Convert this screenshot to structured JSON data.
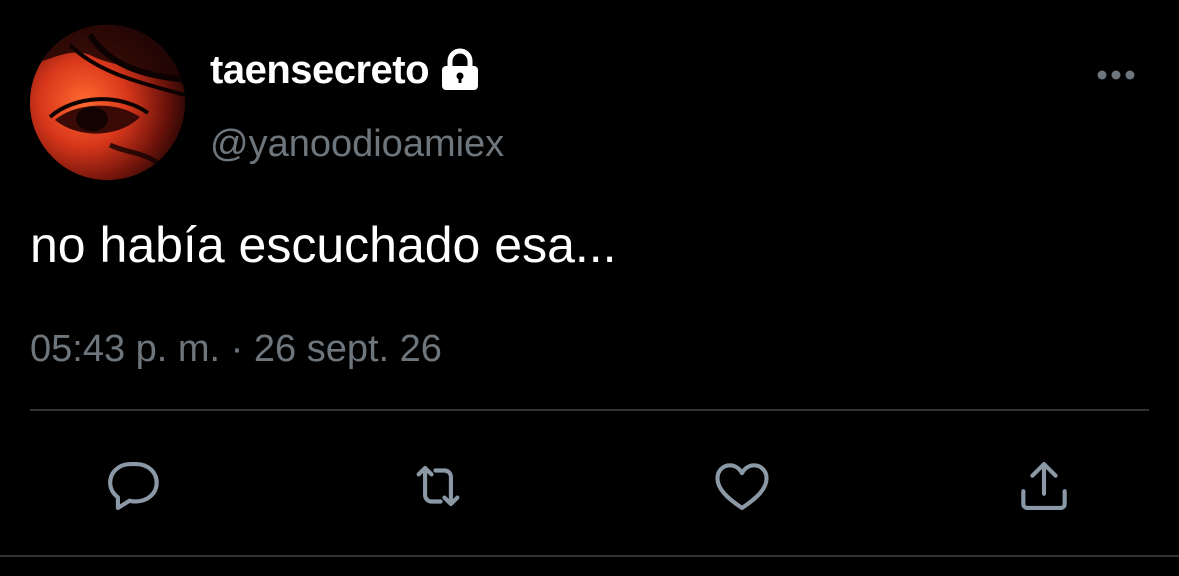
{
  "tweet": {
    "display_name": "taensecreto",
    "handle": "@yanoodioamiex",
    "text": "no había escuchado esa...",
    "timestamp": "05:43 p. m. · 26 sept. 26",
    "protected_icon": "lock-icon",
    "more_icon": "more-horizontal-icon"
  },
  "actions": [
    {
      "name": "reply",
      "icon": "reply-icon"
    },
    {
      "name": "retweet",
      "icon": "retweet-icon"
    },
    {
      "name": "like",
      "icon": "heart-icon"
    },
    {
      "name": "share",
      "icon": "share-icon"
    }
  ],
  "colors": {
    "background": "#000000",
    "primary_text": "#ffffff",
    "secondary_text": "#6e767d",
    "divider": "#2f3336",
    "avatar_tint": "#d8361a"
  }
}
